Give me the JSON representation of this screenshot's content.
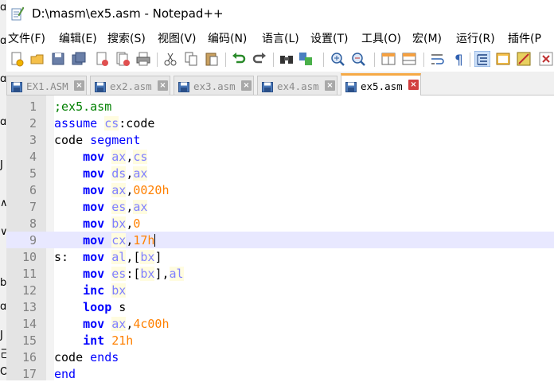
{
  "window": {
    "title": "D:\\masm\\ex5.asm - Notepad++"
  },
  "left_strip": {
    "glyphs": [
      "ɑ",
      "ɑ",
      "ɑ",
      "ɑ",
      "J",
      "∧",
      "∨",
      "b",
      "ɑ",
      "J",
      "己",
      "O"
    ]
  },
  "menu": [
    "文件(F)",
    "编辑(E)",
    "搜索(S)",
    "视图(V)",
    "编码(N)",
    "语言(L)",
    "设置(T)",
    "工具(O)",
    "宏(M)",
    "运行(R)",
    "插件(P"
  ],
  "toolbar": {
    "buttons": [
      "new-file-icon",
      "open-file-icon",
      "save-icon",
      "save-all-icon",
      "close-icon",
      "close-all-icon",
      "print-icon",
      "cut-icon",
      "copy-icon",
      "paste-icon",
      "undo-icon",
      "redo-icon",
      "find-icon",
      "replace-icon",
      "zoom-in-icon",
      "zoom-out-icon",
      "sync-vertical-icon",
      "sync-horizontal-icon",
      "word-wrap-icon",
      "show-all-chars-icon",
      "indent-guide-icon",
      "doc-map-icon",
      "function-list-icon",
      "macro-close-icon"
    ]
  },
  "tabs": [
    {
      "name": "EX1.ASM",
      "active": false
    },
    {
      "name": "ex2.asm",
      "active": false
    },
    {
      "name": "ex3.asm",
      "active": false
    },
    {
      "name": "ex4.asm",
      "active": false
    },
    {
      "name": "ex5.asm",
      "active": true
    }
  ],
  "editor": {
    "current_line": 9,
    "lines": [
      {
        "n": "1",
        "tokens": [
          [
            "comment",
            ";ex5.asm"
          ]
        ]
      },
      {
        "n": "2",
        "tokens": [
          [
            "dir",
            "assume"
          ],
          [
            "plain",
            " "
          ],
          [
            "reg",
            "cs"
          ],
          [
            "plain",
            ":code"
          ]
        ]
      },
      {
        "n": "3",
        "tokens": [
          [
            "plain",
            "code "
          ],
          [
            "dir",
            "segment"
          ]
        ]
      },
      {
        "n": "4",
        "tokens": [
          [
            "plain",
            "    "
          ],
          [
            "instr",
            "mov"
          ],
          [
            "plain",
            " "
          ],
          [
            "reg",
            "ax"
          ],
          [
            "plain",
            ","
          ],
          [
            "reg",
            "cs"
          ]
        ]
      },
      {
        "n": "5",
        "tokens": [
          [
            "plain",
            "    "
          ],
          [
            "instr",
            "mov"
          ],
          [
            "plain",
            " "
          ],
          [
            "reg",
            "ds"
          ],
          [
            "plain",
            ","
          ],
          [
            "reg",
            "ax"
          ]
        ]
      },
      {
        "n": "6",
        "tokens": [
          [
            "plain",
            "    "
          ],
          [
            "instr",
            "mov"
          ],
          [
            "plain",
            " "
          ],
          [
            "reg",
            "ax"
          ],
          [
            "plain",
            ","
          ],
          [
            "num",
            "0020h"
          ]
        ]
      },
      {
        "n": "7",
        "tokens": [
          [
            "plain",
            "    "
          ],
          [
            "instr",
            "mov"
          ],
          [
            "plain",
            " "
          ],
          [
            "reg",
            "es"
          ],
          [
            "plain",
            ","
          ],
          [
            "reg",
            "ax"
          ]
        ]
      },
      {
        "n": "8",
        "tokens": [
          [
            "plain",
            "    "
          ],
          [
            "instr",
            "mov"
          ],
          [
            "plain",
            " "
          ],
          [
            "reg",
            "bx"
          ],
          [
            "plain",
            ","
          ],
          [
            "num",
            "0"
          ]
        ]
      },
      {
        "n": "9",
        "tokens": [
          [
            "plain",
            "    "
          ],
          [
            "instr",
            "mov"
          ],
          [
            "plain",
            " "
          ],
          [
            "reg",
            "cx"
          ],
          [
            "plain",
            ","
          ],
          [
            "num",
            "17h"
          ]
        ]
      },
      {
        "n": "10",
        "tokens": [
          [
            "plain",
            "s:  "
          ],
          [
            "instr",
            "mov"
          ],
          [
            "plain",
            " "
          ],
          [
            "reg",
            "al"
          ],
          [
            "plain",
            ",["
          ],
          [
            "reg",
            "bx"
          ],
          [
            "plain",
            "]"
          ]
        ]
      },
      {
        "n": "11",
        "tokens": [
          [
            "plain",
            "    "
          ],
          [
            "instr",
            "mov"
          ],
          [
            "plain",
            " "
          ],
          [
            "reg",
            "es"
          ],
          [
            "plain",
            ":["
          ],
          [
            "reg",
            "bx"
          ],
          [
            "plain",
            "],"
          ],
          [
            "reg",
            "al"
          ]
        ]
      },
      {
        "n": "12",
        "tokens": [
          [
            "plain",
            "    "
          ],
          [
            "instr",
            "inc"
          ],
          [
            "plain",
            " "
          ],
          [
            "reg",
            "bx"
          ]
        ]
      },
      {
        "n": "13",
        "tokens": [
          [
            "plain",
            "    "
          ],
          [
            "instr",
            "loop"
          ],
          [
            "plain",
            " s"
          ]
        ]
      },
      {
        "n": "14",
        "tokens": [
          [
            "plain",
            "    "
          ],
          [
            "instr",
            "mov"
          ],
          [
            "plain",
            " "
          ],
          [
            "reg",
            "ax"
          ],
          [
            "plain",
            ","
          ],
          [
            "num",
            "4c00h"
          ]
        ]
      },
      {
        "n": "15",
        "tokens": [
          [
            "plain",
            "    "
          ],
          [
            "instr",
            "int"
          ],
          [
            "plain",
            " "
          ],
          [
            "num",
            "21h"
          ]
        ]
      },
      {
        "n": "16",
        "tokens": [
          [
            "plain",
            "code "
          ],
          [
            "dir",
            "ends"
          ]
        ]
      },
      {
        "n": "17",
        "tokens": [
          [
            "dir",
            "end"
          ]
        ]
      }
    ]
  }
}
